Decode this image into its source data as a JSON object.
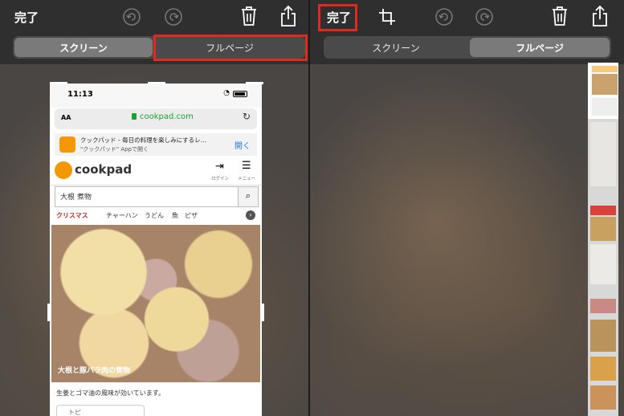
{
  "left_panel": {
    "done_label": "完了",
    "segments": [
      "スクリーン",
      "フルページ"
    ],
    "selected_segment": 0,
    "highlighted_segment": 1
  },
  "right_panel": {
    "done_label": "完了",
    "segments": [
      "スクリーン",
      "フルページ"
    ],
    "selected_segment": 1
  },
  "phone": {
    "time": "11:13",
    "aa_label": "AA",
    "url": "cookpad.com",
    "banner_title": "クックパッド - 毎日の料理を楽しみにするレ...",
    "banner_sub": "\"クックパッド\" Appで開く",
    "banner_open": "開く",
    "logo_text": "cookpad",
    "login_label": "ログイン",
    "menu_label": "メニュー",
    "search_value": "大根 煮物",
    "tags": [
      "クリスマス",
      "チャーハン",
      "うどん",
      "魚",
      "ピザ"
    ],
    "photo_caption": "大根と豚バラ肉の煮物",
    "description": "生姜とゴマ油の風味が効いています。",
    "more_label": "トピ"
  },
  "colors": {
    "highlight_red": "#e02a1e",
    "toolbar_bg": "#2f2f2f",
    "cookpad_orange": "#f39800",
    "url_green": "#1aa332"
  },
  "icons": {
    "undo": "undo-icon",
    "redo": "redo-icon",
    "trash": "trash-icon",
    "share": "share-icon",
    "crop": "crop-icon"
  }
}
